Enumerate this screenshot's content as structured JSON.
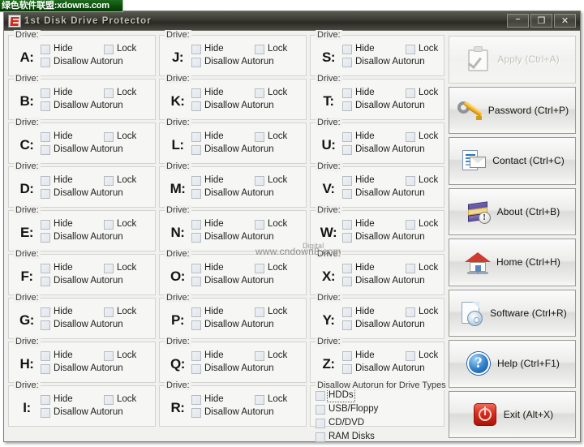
{
  "promo_banner": {
    "text": "绿色软件联盟:xdowns.com"
  },
  "window": {
    "title": "1st Disk Drive Protector",
    "icon": "app-shield-icon",
    "controls": {
      "minimize": "–",
      "maximize": "❐",
      "close": "✕"
    }
  },
  "watermark": {
    "main": "www.cndown8.com",
    "overlay": "Digital"
  },
  "drive_group": {
    "legend": "Drive:",
    "hide_label": "Hide",
    "lock_label": "Lock",
    "autorun_label": "Disallow Autorun"
  },
  "drives": {
    "column1": [
      "A:",
      "B:",
      "C:",
      "D:",
      "E:",
      "F:",
      "G:",
      "H:",
      "I:"
    ],
    "column2": [
      "J:",
      "K:",
      "L:",
      "M:",
      "N:",
      "O:",
      "P:",
      "Q:",
      "R:"
    ],
    "column3": [
      "S:",
      "T:",
      "U:",
      "V:",
      "W:",
      "X:",
      "Y:",
      "Z:"
    ]
  },
  "autorun_types": {
    "legend": "Disallow Autorun for Drive Types",
    "items": [
      {
        "label": "HDDs",
        "checked": false,
        "focused": true
      },
      {
        "label": "USB/Floppy",
        "checked": false,
        "focused": false
      },
      {
        "label": "CD/DVD",
        "checked": false,
        "focused": false
      },
      {
        "label": "RAM Disks",
        "checked": false,
        "focused": false
      }
    ]
  },
  "action_buttons": [
    {
      "label": "Apply (Ctrl+A)",
      "icon": "clipboard-check-icon",
      "name": "apply-button",
      "disabled": true
    },
    {
      "label": "Password (Ctrl+P)",
      "icon": "keys-icon",
      "name": "password-button",
      "disabled": false
    },
    {
      "label": "Contact (Ctrl+C)",
      "icon": "contact-card-icon",
      "name": "contact-button",
      "disabled": false
    },
    {
      "label": "About (Ctrl+B)",
      "icon": "book-info-icon",
      "name": "about-button",
      "disabled": false
    },
    {
      "label": "Home (Ctrl+H)",
      "icon": "home-icon",
      "name": "home-button",
      "disabled": false
    },
    {
      "label": "Software (Ctrl+R)",
      "icon": "software-disc-icon",
      "name": "software-button",
      "disabled": false
    },
    {
      "label": "Help (Ctrl+F1)",
      "icon": "question-circle-icon",
      "name": "help-button",
      "disabled": false
    },
    {
      "label": "Exit (Alt+X)",
      "icon": "power-exit-icon",
      "name": "exit-button",
      "disabled": false
    }
  ]
}
